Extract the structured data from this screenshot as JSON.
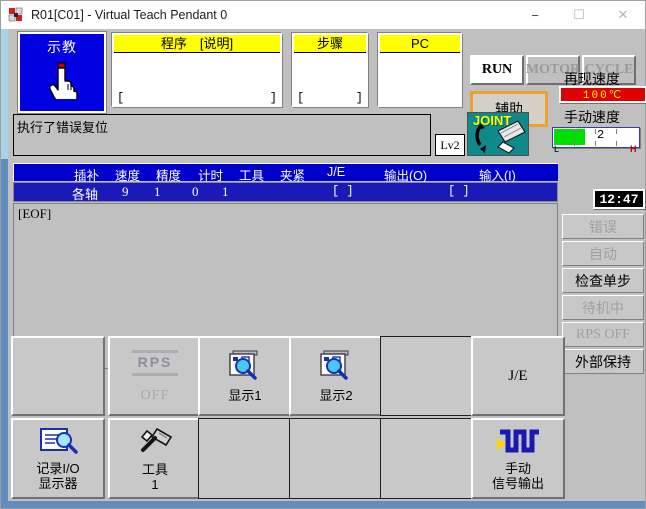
{
  "window": {
    "title": "R01[C01] - Virtual Teach Pendant 0",
    "icon": "robot-app-icon",
    "minimize": "−",
    "maximize": "☐",
    "close": "✕"
  },
  "mode": {
    "teach_label": "示教",
    "teach_icon": "pointing-hand-icon",
    "teach_active_color": "#0000e0"
  },
  "boxes": [
    {
      "name": "program",
      "header": "程序　[说明]",
      "value": "",
      "bracket_left": "[",
      "bracket_right": "]"
    },
    {
      "name": "step",
      "header": "步骤",
      "value": "",
      "bracket_left": "[",
      "bracket_right": "]"
    },
    {
      "name": "pc",
      "header": "PC",
      "value": "",
      "bracket_left": "",
      "bracket_right": ""
    }
  ],
  "run_buttons": [
    {
      "label": "RUN",
      "enabled": true
    },
    {
      "label": "MOTOR",
      "enabled": false
    },
    {
      "label": "CYCLE",
      "enabled": false
    }
  ],
  "aux_button": {
    "label": "辅助",
    "highlight_color": "#f0a030"
  },
  "speeds": {
    "playback_title": "再现速度",
    "playback_value": "100℃",
    "playback_color": "#e00000",
    "manual_title": "手动速度",
    "manual_value": "2",
    "manual_fill_percent": 36,
    "manual_fill_color": "#00e000",
    "manual_low": "L",
    "manual_high": "H"
  },
  "message": {
    "text": "执行了错误复位"
  },
  "level": {
    "label": "Lv2"
  },
  "joint": {
    "label": "JOINT",
    "icon": "robot-arm-icon",
    "bg_color": "#0f8a8a"
  },
  "table": {
    "headers": [
      "插补",
      "速度",
      "精度",
      "计时",
      "工具",
      "夹紧",
      "J/E",
      "输出(O)",
      "输入(I)"
    ],
    "row": {
      "interp": "各轴",
      "speed": "9",
      "accuracy": "1",
      "timer": "0",
      "tool": "1",
      "clamp": "",
      "je": "",
      "output": "[                    ]",
      "input": "[                      ]"
    }
  },
  "code": {
    "lines": [
      "[EOF]"
    ]
  },
  "clock": {
    "time": "12:47"
  },
  "status_buttons": [
    {
      "label": "错误",
      "active": false
    },
    {
      "label": "自动",
      "active": false
    },
    {
      "label": "检查单步",
      "active": true
    },
    {
      "label": "待机中",
      "active": false
    },
    {
      "label": "RPS OFF",
      "active": false
    },
    {
      "label": "外部保持",
      "active": true
    }
  ],
  "function_keys": {
    "col1_top": {
      "label": "",
      "icon": "",
      "kind": "blank-raised"
    },
    "col1_bot": {
      "label": "记录I/O",
      "label2": "显示器",
      "icon": "document-search-icon",
      "kind": "icon"
    },
    "col2_top": {
      "label": "RPS",
      "sub": "OFF",
      "icon": "rps-disabled-icon",
      "kind": "rps"
    },
    "col2_bot": {
      "label": "工具",
      "label2": "1",
      "icon": "tool-icon",
      "kind": "icon"
    },
    "col3_top": {
      "label": "显示1",
      "icon": "monitor-search-icon",
      "kind": "icon"
    },
    "col3_bot": {
      "label": "",
      "icon": "",
      "kind": "blank-flat"
    },
    "col4_top": {
      "label": "显示2",
      "icon": "monitor-search-icon",
      "kind": "icon"
    },
    "col4_bot": {
      "label": "",
      "icon": "",
      "kind": "blank-flat"
    },
    "col5_top": {
      "label": "",
      "icon": "",
      "kind": "blank-flat"
    },
    "col5_bot": {
      "label": "",
      "icon": "",
      "kind": "blank-flat"
    },
    "col6_top": {
      "label": "J/E",
      "icon": "",
      "kind": "text"
    },
    "col6_bot": {
      "label": "手动",
      "label2": "信号输出",
      "icon": "signal-output-icon",
      "kind": "icon"
    }
  }
}
